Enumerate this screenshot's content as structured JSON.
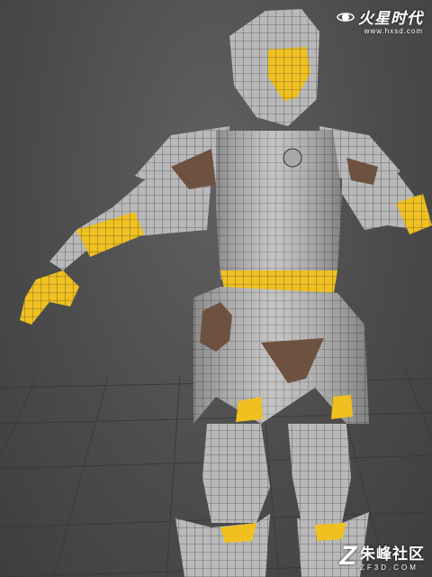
{
  "viewport": {
    "background": "#4e4e4e",
    "grid_color": "#3a3a3a"
  },
  "model": {
    "armor_color": "#b9b9b9",
    "wire_color": "#2b2b2b",
    "skin_color": "#f0c020",
    "leather_color": "#6e5240"
  },
  "watermark_top": {
    "icon": "planet-logo-icon",
    "brand": "火星时代",
    "url": "www.hxsd.com"
  },
  "watermark_bottom": {
    "icon": "z-logo-icon",
    "brand": "朱峰社区",
    "url": "ZF3D.COM"
  }
}
